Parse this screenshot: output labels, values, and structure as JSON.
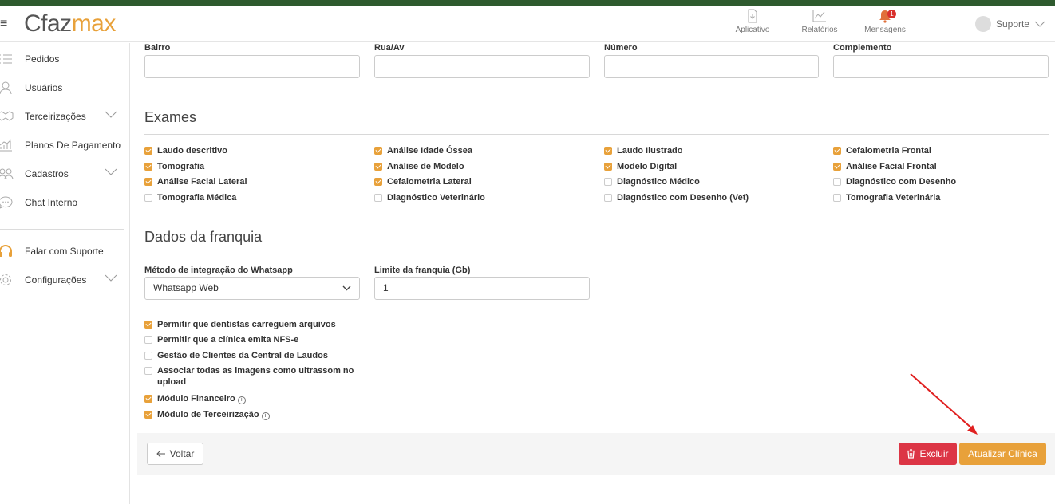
{
  "header": {
    "logo_part1": "Cfaz",
    "logo_part2": "max",
    "nav": [
      {
        "label": "Aplicativo",
        "icon": "download-doc-icon"
      },
      {
        "label": "Relatórios",
        "icon": "chart-icon"
      },
      {
        "label": "Mensagens",
        "icon": "bell-icon",
        "badge": "1"
      }
    ],
    "user": "Suporte"
  },
  "sidebar": {
    "items": [
      {
        "label": "Pedidos",
        "icon": "list-icon"
      },
      {
        "label": "Usuários",
        "icon": "user-icon"
      },
      {
        "label": "Terceirizações",
        "icon": "handshake-icon"
      },
      {
        "label": "Planos De Pagamento",
        "icon": "growth-icon"
      },
      {
        "label": "Cadastros",
        "icon": "users-icon"
      },
      {
        "label": "Chat Interno",
        "icon": "chat-icon"
      },
      {
        "label": "Falar com Suporte",
        "icon": "headset-icon"
      },
      {
        "label": "Configurações",
        "icon": "gear-icon"
      }
    ]
  },
  "address": {
    "fields": [
      {
        "label": "Bairro",
        "value": ""
      },
      {
        "label": "Rua/Av",
        "value": ""
      },
      {
        "label": "Número",
        "value": ""
      },
      {
        "label": "Complemento",
        "value": ""
      }
    ]
  },
  "exams": {
    "title": "Exames",
    "items": [
      {
        "label": "Laudo descritivo",
        "checked": true
      },
      {
        "label": "Análise Idade Óssea",
        "checked": true
      },
      {
        "label": "Laudo Ilustrado",
        "checked": true
      },
      {
        "label": "Cefalometria Frontal",
        "checked": true
      },
      {
        "label": "Tomografia",
        "checked": true
      },
      {
        "label": "Análise de Modelo",
        "checked": true
      },
      {
        "label": "Modelo Digital",
        "checked": true
      },
      {
        "label": "Análise Facial Frontal",
        "checked": true
      },
      {
        "label": "Análise Facial Lateral",
        "checked": true
      },
      {
        "label": "Cefalometria Lateral",
        "checked": true
      },
      {
        "label": "Diagnóstico Médico",
        "checked": false
      },
      {
        "label": "Diagnóstico com Desenho",
        "checked": false
      },
      {
        "label": "Tomografia Médica",
        "checked": false
      },
      {
        "label": "Diagnóstico Veterinário",
        "checked": false
      },
      {
        "label": "Diagnóstico com Desenho (Vet)",
        "checked": false
      },
      {
        "label": "Tomografia Veterinária",
        "checked": false
      }
    ]
  },
  "franchise": {
    "title": "Dados da franquia",
    "whatsapp_label": "Método de integração do Whatsapp",
    "whatsapp_value": "Whatsapp Web",
    "limit_label": "Limite da franquia (Gb)",
    "limit_value": "1",
    "options": [
      {
        "label": "Permitir que dentistas carreguem arquivos",
        "checked": true
      },
      {
        "label": "Permitir que a clínica emita NFS-e",
        "checked": false
      },
      {
        "label": "Gestão de Clientes da Central de Laudos",
        "checked": false
      },
      {
        "label": "Associar todas as imagens como ultrassom no",
        "label2": "upload",
        "checked": false
      },
      {
        "label": "Módulo Financeiro",
        "checked": true,
        "info": true
      },
      {
        "label": "Módulo de Terceirização",
        "checked": true,
        "info": true
      }
    ]
  },
  "footer": {
    "back": "Voltar",
    "delete": "Excluir",
    "update": "Atualizar Clínica"
  },
  "colors": {
    "accent": "#e8a13a",
    "danger": "#dc3545",
    "topbar": "#2e5a2e"
  }
}
